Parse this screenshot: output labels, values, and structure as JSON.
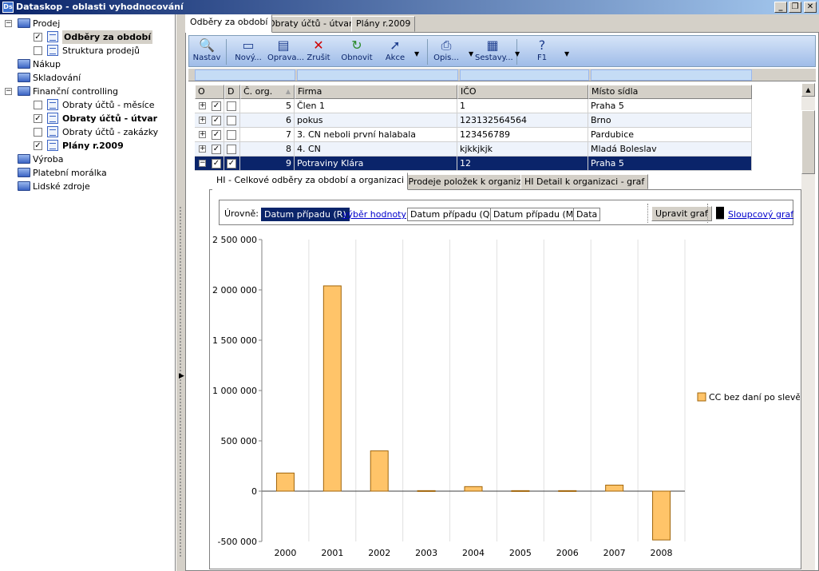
{
  "window": {
    "title": "Dataskop - oblasti vyhodnocování"
  },
  "tree": [
    {
      "label": "Prodej",
      "level": 0,
      "kind": "folder",
      "expand": "−",
      "bold": false
    },
    {
      "label": "Odběry za období",
      "level": 1,
      "kind": "report",
      "checked": true,
      "bold": true,
      "selected": true
    },
    {
      "label": "Struktura prodejů",
      "level": 1,
      "kind": "report",
      "checked": false,
      "bold": false
    },
    {
      "label": "Nákup",
      "level": 0,
      "kind": "folder",
      "bold": false
    },
    {
      "label": "Skladování",
      "level": 0,
      "kind": "folder",
      "bold": false
    },
    {
      "label": "Finanční controlling",
      "level": 0,
      "kind": "folder",
      "expand": "−",
      "bold": false
    },
    {
      "label": "Obraty účtů - měsíce",
      "level": 1,
      "kind": "report",
      "checked": false,
      "bold": false
    },
    {
      "label": "Obraty účtů - útvar",
      "level": 1,
      "kind": "report",
      "checked": true,
      "bold": true
    },
    {
      "label": "Obraty účtů - zakázky",
      "level": 1,
      "kind": "report",
      "checked": false,
      "bold": false
    },
    {
      "label": "Plány r.2009",
      "level": 1,
      "kind": "report",
      "checked": true,
      "bold": true
    },
    {
      "label": "Výroba",
      "level": 0,
      "kind": "folder",
      "bold": false
    },
    {
      "label": "Platební morálka",
      "level": 0,
      "kind": "folder",
      "bold": false
    },
    {
      "label": "Lidské zdroje",
      "level": 0,
      "kind": "folder",
      "bold": false
    }
  ],
  "tabs": [
    "Odběry za období",
    "Obraty účtů - útvary",
    "Plány r.2009"
  ],
  "toolbar": [
    {
      "label": "Nastav",
      "icon": "magnifier-icon",
      "glyph": "🔍",
      "color": "#1f5fbf"
    },
    {
      "label": "Nový...",
      "icon": "new-window-icon",
      "glyph": "▭",
      "color": "#1f3f8f"
    },
    {
      "label": "Oprava...",
      "icon": "edit-form-icon",
      "glyph": "▤",
      "color": "#1f3f8f"
    },
    {
      "label": "Zrušit",
      "icon": "delete-cross-icon",
      "glyph": "✕",
      "color": "#d00000"
    },
    {
      "label": "Obnovit",
      "icon": "refresh-icon",
      "glyph": "↻",
      "color": "#2a8a2a"
    },
    {
      "label": "Akce",
      "icon": "cursor-action-icon",
      "glyph": "➚",
      "color": "#1f3f8f"
    },
    {
      "label": "Opis...",
      "icon": "printer-icon",
      "glyph": "⎙",
      "color": "#1f3f8f"
    },
    {
      "label": "Sestavy...",
      "icon": "report-printer-icon",
      "glyph": "▦",
      "color": "#1f3f8f"
    },
    {
      "label": "F1",
      "icon": "help-icon",
      "glyph": "?",
      "color": "#1f3f8f"
    }
  ],
  "grid": {
    "headers": [
      "O",
      "D",
      "Č. org.",
      "Firma",
      "IČO",
      "Místo sídla"
    ],
    "rows": [
      {
        "o": true,
        "d": false,
        "corg": "5",
        "firma": "Člen 1",
        "ico": "1",
        "misto": "Praha 5",
        "exp": "+"
      },
      {
        "o": true,
        "d": false,
        "corg": "6",
        "firma": "pokus",
        "ico": "123132564564",
        "misto": "Brno",
        "exp": "+"
      },
      {
        "o": true,
        "d": false,
        "corg": "7",
        "firma": "3. CN neboli první halabala",
        "ico": "123456789",
        "misto": "Pardubice",
        "exp": "+"
      },
      {
        "o": true,
        "d": false,
        "corg": "8",
        "firma": "4. CN",
        "ico": "kjkkjkjk",
        "misto": "Mladá Boleslav",
        "exp": "+"
      },
      {
        "o": true,
        "d": true,
        "corg": "9",
        "firma": "Potraviny  Klára",
        "ico": "12",
        "misto": "Praha 5",
        "exp": "−",
        "selected": true
      }
    ]
  },
  "subtabs": [
    "HI - Celkové odběry za období a organizaci",
    "HI - Prodeje položek k organizaci",
    "HI Detail k organizaci - graf"
  ],
  "levels": {
    "label": "Úrovně:",
    "items": [
      "Datum případu (R)",
      "výběr hodnoty",
      "Datum případu (Q)",
      "Datum případu (M)",
      "Data"
    ],
    "edit_button": "Upravit graf",
    "chart_type_link": "Sloupcový graf"
  },
  "chart_data": {
    "type": "bar",
    "categories": [
      "2000",
      "2001",
      "2002",
      "2003",
      "2004",
      "2005",
      "2006",
      "2007",
      "2008"
    ],
    "series": [
      {
        "name": "CC bez daní po slevě",
        "values": [
          180000,
          2040000,
          400000,
          5000,
          45000,
          5000,
          5000,
          60000,
          -485000
        ]
      }
    ],
    "ylim": [
      -500000,
      2500000
    ],
    "yticks": [
      "2 500 000",
      "2 000 000",
      "1 500 000",
      "1 000 000",
      "500 000",
      "0",
      "-500 000"
    ],
    "ytick_values": [
      2500000,
      2000000,
      1500000,
      1000000,
      500000,
      0,
      -500000
    ],
    "grid": true,
    "legend": "right",
    "bar_color": "#ffc469",
    "bar_stroke": "#a0650a"
  }
}
